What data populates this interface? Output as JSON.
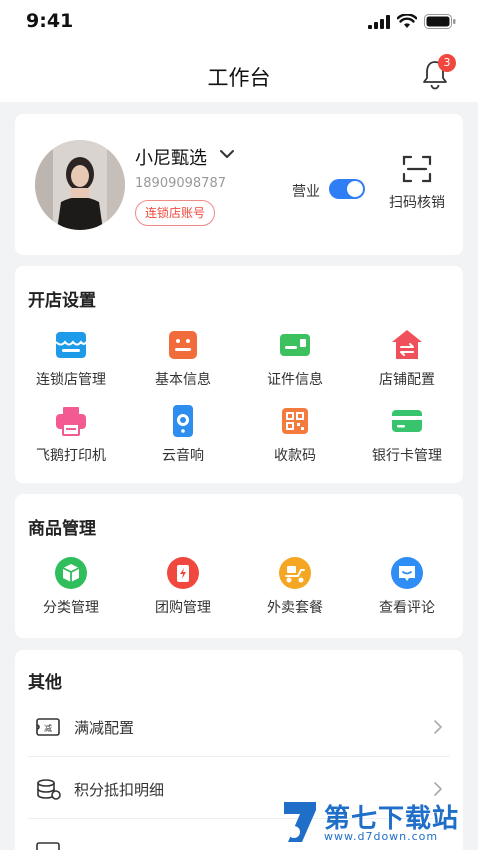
{
  "status_bar": {
    "time": "9:41"
  },
  "nav": {
    "title": "工作台",
    "notification_count": "3"
  },
  "profile": {
    "shop_name": "小尼甄选",
    "phone": "18909098787",
    "tag": "连锁店账号",
    "business_label": "营业",
    "business_open": true,
    "scan_label": "扫码核销"
  },
  "store_settings": {
    "title": "开店设置",
    "items": [
      {
        "label": "连锁店管理",
        "icon": "chain-store-icon",
        "color": "#1e9be8"
      },
      {
        "label": "基本信息",
        "icon": "basic-info-icon",
        "color": "#f26b3a"
      },
      {
        "label": "证件信息",
        "icon": "certificate-icon",
        "color": "#3cc15e"
      },
      {
        "label": "店铺配置",
        "icon": "store-config-icon",
        "color": "#f0505a"
      },
      {
        "label": "飞鹅打印机",
        "icon": "printer-icon",
        "color": "#f45a92"
      },
      {
        "label": "云音响",
        "icon": "speaker-icon",
        "color": "#2e8ef0"
      },
      {
        "label": "收款码",
        "icon": "qr-code-icon",
        "color": "#f47a3d"
      },
      {
        "label": "银行卡管理",
        "icon": "bank-card-icon",
        "color": "#38c46c"
      }
    ]
  },
  "goods_management": {
    "title": "商品管理",
    "items": [
      {
        "label": "分类管理",
        "icon": "category-icon",
        "color": "#2fbe5b"
      },
      {
        "label": "团购管理",
        "icon": "group-buy-icon",
        "color": "#f0483e"
      },
      {
        "label": "外卖套餐",
        "icon": "delivery-icon",
        "color": "#f5a623"
      },
      {
        "label": "查看评论",
        "icon": "comment-icon",
        "color": "#2f8ef5"
      }
    ]
  },
  "other": {
    "title": "其他",
    "rows": [
      {
        "label": "满减配置",
        "icon": "discount-icon"
      },
      {
        "label": "积分抵扣明细",
        "icon": "points-icon"
      },
      {
        "label": "",
        "icon": "list-icon"
      }
    ]
  },
  "watermark": {
    "text": "第七下载站",
    "url": "www.d7down.com"
  }
}
